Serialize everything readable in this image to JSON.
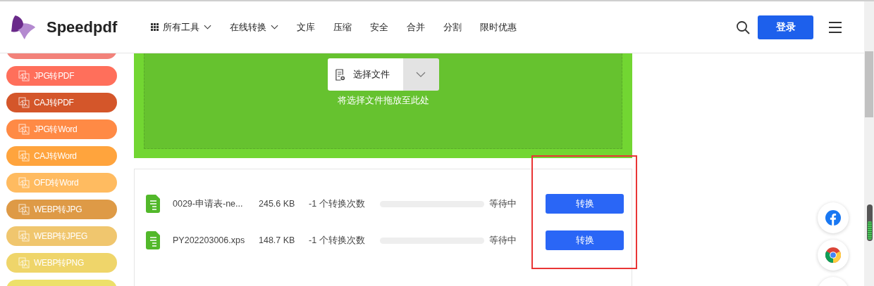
{
  "header": {
    "brand": "Speedpdf",
    "nav": [
      {
        "label": "所有工具",
        "kind": "grid-menu"
      },
      {
        "label": "在线转换",
        "kind": "menu"
      },
      {
        "label": "文库",
        "kind": "link"
      },
      {
        "label": "压缩",
        "kind": "link"
      },
      {
        "label": "安全",
        "kind": "link"
      },
      {
        "label": "合并",
        "kind": "link"
      },
      {
        "label": "分割",
        "kind": "link"
      },
      {
        "label": "限时优惠",
        "kind": "link"
      }
    ],
    "login": "登录"
  },
  "sidebar": {
    "items": [
      {
        "color": "#f2827a"
      },
      {
        "label": "JPG转PDF",
        "color": "#ff6f5b"
      },
      {
        "label": "CAJ转PDF",
        "color": "#d4562a"
      },
      {
        "label": "JPG转Word",
        "color": "#ff8a45"
      },
      {
        "label": "CAJ转Word",
        "color": "#ffa43d"
      },
      {
        "label": "OFD转Word",
        "color": "#ffbb60"
      },
      {
        "label": "WEBP转JPG",
        "color": "#de9a46"
      },
      {
        "label": "WEBP转JPEG",
        "color": "#f0c66e"
      },
      {
        "label": "WEBP转PNG",
        "color": "#efd56a"
      },
      {
        "color": "#ede06a"
      }
    ]
  },
  "upload": {
    "button": "选择文件",
    "hint": "将选择文件拖放至此处"
  },
  "files": [
    {
      "name": "0029-申请表-ne...",
      "size": "245.6 KB",
      "count": "-1 个转换次数",
      "level": 0,
      "status": "等待中",
      "action": "转换"
    },
    {
      "name": "PY202203006.xps",
      "size": "148.7 KB",
      "count": "-1 个转换次数",
      "level": 0,
      "status": "等待中",
      "action": "转换"
    }
  ]
}
